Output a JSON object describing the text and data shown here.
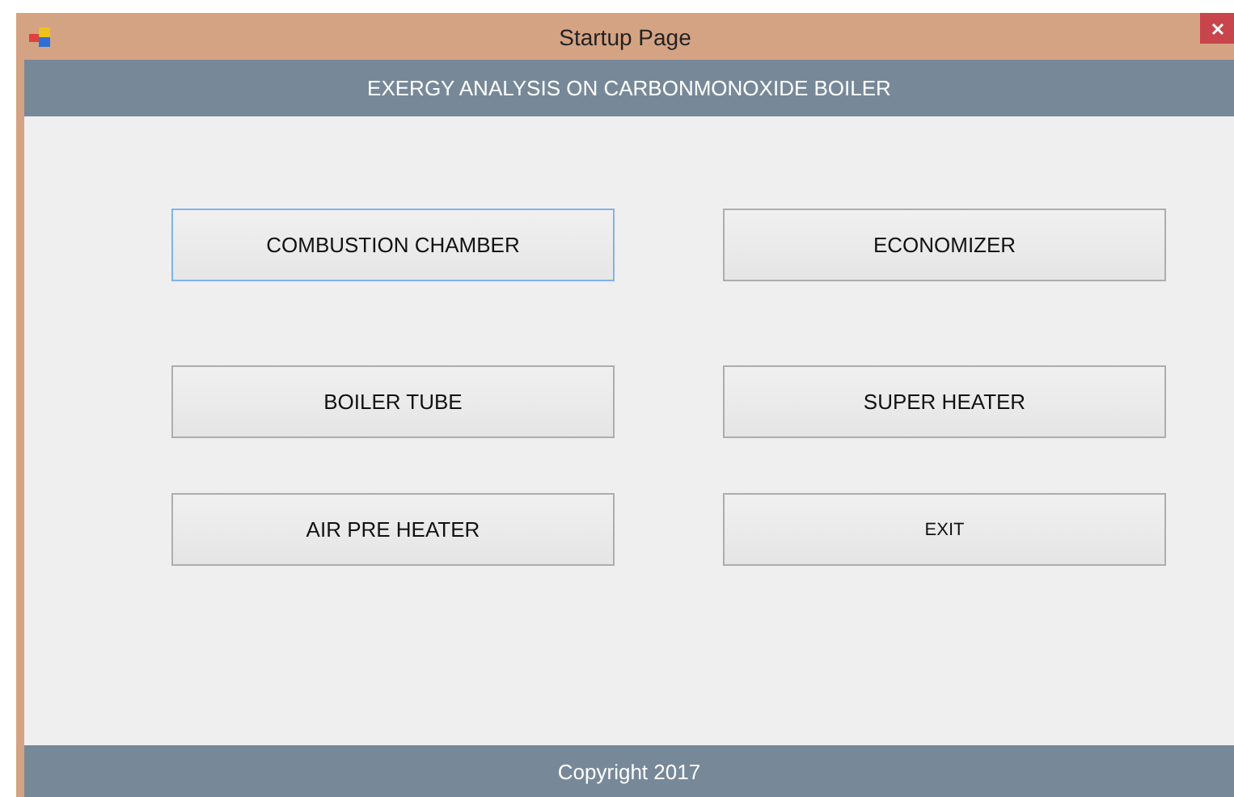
{
  "window": {
    "title": "Startup Page"
  },
  "header": {
    "title": "EXERGY ANALYSIS ON CARBONMONOXIDE BOILER"
  },
  "buttons": [
    {
      "label": "COMBUSTION CHAMBER",
      "kind": "section",
      "focused": true
    },
    {
      "label": "ECONOMIZER",
      "kind": "section",
      "focused": false
    },
    {
      "label": "BOILER TUBE",
      "kind": "section",
      "focused": false
    },
    {
      "label": "SUPER HEATER",
      "kind": "section",
      "focused": false
    },
    {
      "label": "AIR PRE HEATER",
      "kind": "section",
      "focused": false
    },
    {
      "label": "EXIT",
      "kind": "exit",
      "focused": false
    }
  ],
  "footer": {
    "text": "Copyright 2017"
  }
}
